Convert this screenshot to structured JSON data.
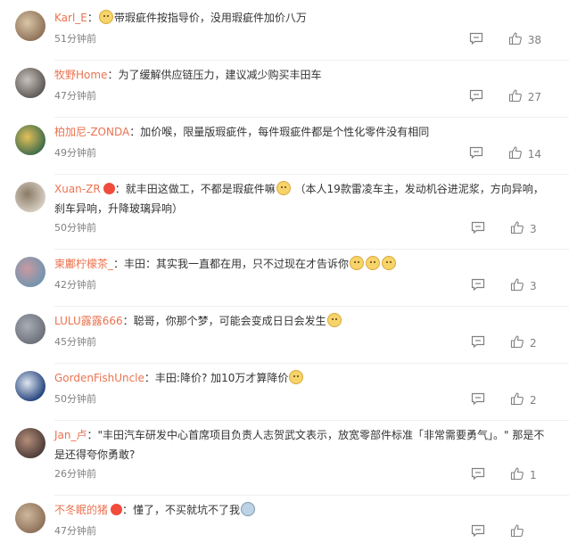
{
  "colors": {
    "username": "#eb7350",
    "meta": "#808080",
    "text": "#333333"
  },
  "icons": {
    "reply": "comment-bubble-icon",
    "like": "thumbs-up-icon",
    "emoji": "doge-emoji",
    "badge": "heart-badge"
  },
  "comments": [
    {
      "user": "Karl_E",
      "sep": "：",
      "parts": [
        {
          "emoji": "dog"
        },
        {
          "text": "带瑕疵件按指导价，没用瑕疵件加价八万"
        }
      ],
      "time": "51分钟前",
      "likes": "38",
      "avatar": [
        "#8c6f56",
        "#d9c6a7"
      ]
    },
    {
      "user": "牧野Home",
      "sep": "：",
      "parts": [
        {
          "text": "为了缓解供应链压力，建议减少购买丰田车"
        }
      ],
      "time": "47分钟前",
      "likes": "27",
      "avatar": [
        "#5b5551",
        "#c6c2bd"
      ]
    },
    {
      "user": "柏加尼-ZONDA",
      "sep": "：",
      "parts": [
        {
          "text": "加价喉，限量版瑕疵件，每件瑕疵件都是个性化零件没有相同"
        }
      ],
      "time": "49分钟前",
      "likes": "14",
      "avatar": [
        "#3a6a4a",
        "#e4c05a"
      ]
    },
    {
      "user": "Xuan-ZR",
      "badge": true,
      "sep": "：",
      "parts": [
        {
          "text": "就丰田这做工，不都是瑕疵件嘛"
        },
        {
          "emoji": "dog"
        },
        {
          "text": " （本人19款雷凌车主，发动机谷进泥浆，方向异响，刹车异响，升降玻璃异响）"
        }
      ],
      "time": "50分钟前",
      "likes": "3",
      "avatar": [
        "#d8d0c4",
        "#8a7a66"
      ]
    },
    {
      "user": "柬鄘柠檬茶_",
      "sep": "：",
      "parts": [
        {
          "text": "丰田：其实我一直都在用，只不过现在才告诉你"
        },
        {
          "emoji": "dog"
        },
        {
          "emoji": "dog"
        },
        {
          "emoji": "dog"
        }
      ],
      "time": "42分钟前",
      "likes": "3",
      "avatar": [
        "#6f94b0",
        "#c99aa0"
      ]
    },
    {
      "user": "LULU露露666",
      "sep": "：",
      "parts": [
        {
          "text": "聪哥，你那个梦，可能会变成日日会发生"
        },
        {
          "emoji": "dog"
        }
      ],
      "time": "45分钟前",
      "likes": "2",
      "avatar": [
        "#6a6e78",
        "#a9adb6"
      ]
    },
    {
      "user": "GordenFishUncle",
      "sep": "：",
      "parts": [
        {
          "text": "丰田:降价? 加10万才算降价"
        },
        {
          "emoji": "dog"
        }
      ],
      "time": "50分钟前",
      "likes": "2",
      "avatar": [
        "#1f3f7a",
        "#dfe6ef"
      ]
    },
    {
      "user": "Jan_卢",
      "sep": "：",
      "parts": [
        {
          "text": "\"丰田汽车研发中心首席项目负责人志贺武文表示，放宽零部件标准「非常需要勇气」。\" 那是不是还得夸你勇敢?"
        }
      ],
      "time": "26分钟前",
      "likes": "1",
      "avatar": [
        "#4a3a36",
        "#b58e7a"
      ]
    },
    {
      "user": "不冬眠的猪",
      "badge": true,
      "sep": "：",
      "parts": [
        {
          "text": "懂了，不买就坑不了我"
        },
        {
          "emoji": "face"
        }
      ],
      "time": "47分钟前",
      "likes": "",
      "avatar": [
        "#8c6f56",
        "#cdb89d"
      ]
    }
  ]
}
